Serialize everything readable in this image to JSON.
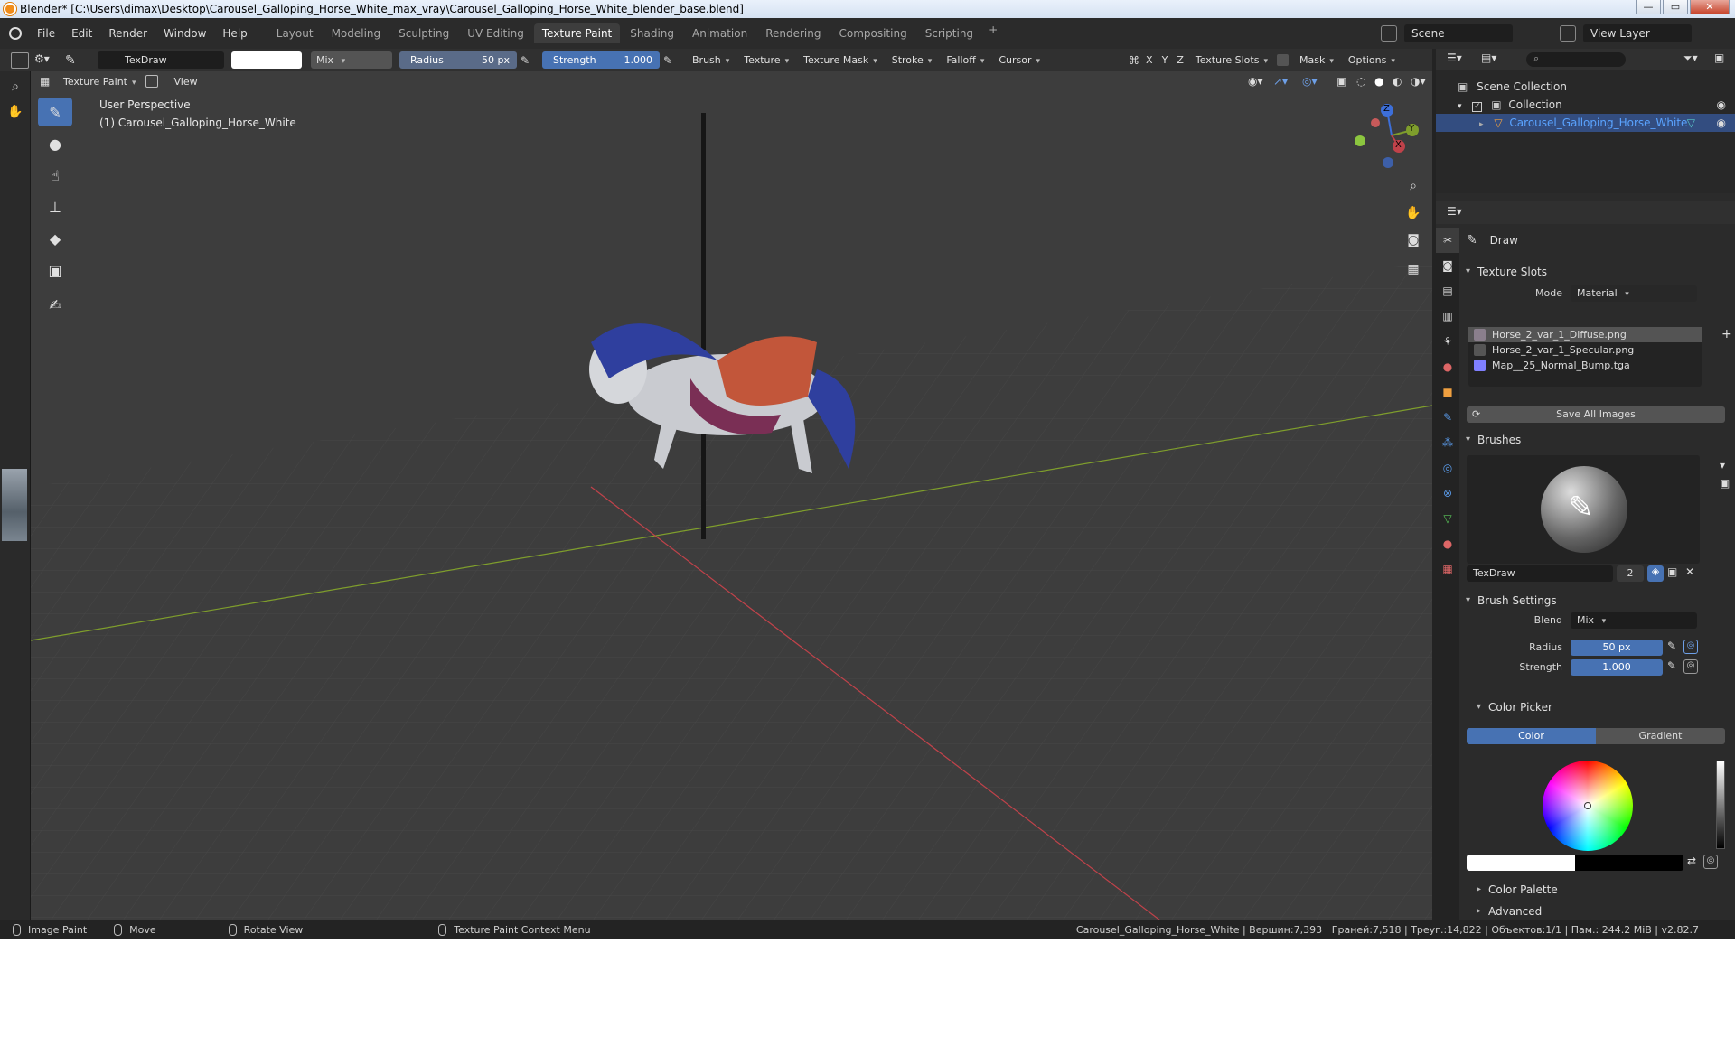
{
  "window": {
    "title": "Blender* [C:\\Users\\dimax\\Desktop\\Carousel_Galloping_Horse_White_max_vray\\Carousel_Galloping_Horse_White_blender_base.blend]",
    "minimize": "—",
    "maximize": "▭",
    "close": "✕"
  },
  "menu": {
    "items": [
      "File",
      "Edit",
      "Render",
      "Window",
      "Help"
    ]
  },
  "workspaces": {
    "tabs": [
      "Layout",
      "Modeling",
      "Sculpting",
      "UV Editing",
      "Texture Paint",
      "Shading",
      "Animation",
      "Rendering",
      "Compositing",
      "Scripting"
    ],
    "active": "Texture Paint",
    "add": "+"
  },
  "scene": {
    "name": "Scene",
    "view_layer": "View Layer"
  },
  "tool_header": {
    "brush_name": "TexDraw",
    "blend": "Mix",
    "radius_label": "Radius",
    "radius_value": "50 px",
    "strength_label": "Strength",
    "strength_value": "1.000",
    "menus": [
      "Brush",
      "Texture",
      "Texture Mask",
      "Stroke",
      "Falloff",
      "Cursor"
    ],
    "axes": [
      "X",
      "Y",
      "Z"
    ],
    "texture_slots": "Texture Slots",
    "mask": "Mask",
    "options": "Options"
  },
  "viewport_header": {
    "mode": "Texture Paint",
    "view": "View"
  },
  "viewport": {
    "perspective": "User Perspective",
    "object": "(1) Carousel_Galloping_Horse_White",
    "gizmo": {
      "z": "Z",
      "y": "Y",
      "x": "X"
    }
  },
  "outliner": {
    "scene_collection": "Scene Collection",
    "collection": "Collection",
    "object": "Carousel_Galloping_Horse_White"
  },
  "properties": {
    "tool_name": "Draw",
    "texture_slots_header": "Texture Slots",
    "mode_label": "Mode",
    "mode_value": "Material",
    "slots": [
      {
        "name": "Horse_2_var_1_Diffuse.png",
        "color": "#8a7f8c"
      },
      {
        "name": "Horse_2_var_1_Specular.png",
        "color": "#555555"
      },
      {
        "name": "Map__25_Normal_Bump.tga",
        "color": "#8080ff"
      }
    ],
    "save_all": "Save All Images",
    "brushes_header": "Brushes",
    "brush_name": "TexDraw",
    "brush_users": "2",
    "brush_settings_header": "Brush Settings",
    "blend_label": "Blend",
    "blend_value": "Mix",
    "radius_label": "Radius",
    "radius_value": "50 px",
    "strength_label": "Strength",
    "strength_value": "1.000",
    "color_picker_header": "Color Picker",
    "color_tab": "Color",
    "gradient_tab": "Gradient",
    "color_palette_header": "Color Palette",
    "advanced_header": "Advanced"
  },
  "status": {
    "left_items": [
      "Image Paint",
      "Move",
      "Rotate View",
      "Texture Paint Context Menu"
    ],
    "stats": "Carousel_Galloping_Horse_White | Вершин:7,393 | Граней:7,518 | Треуг.:14,822 | Объектов:1/1 | Пам.: 244.2 MiB | v2.82.7"
  },
  "colors": {
    "accent": "#4772b3",
    "selected_text": "#5aa3ff",
    "viewport_bg": "#3d3d3d",
    "x_axis": "#c0424a",
    "y_axis": "#7f9e2c"
  }
}
